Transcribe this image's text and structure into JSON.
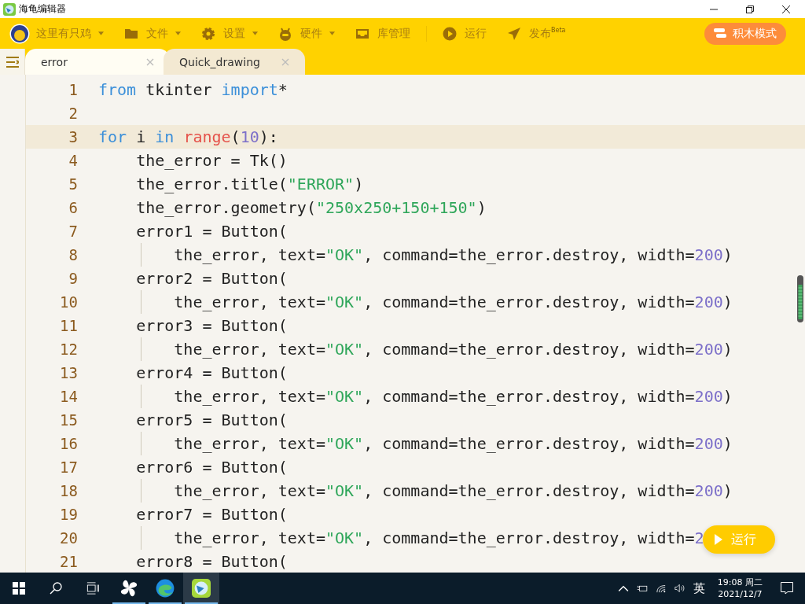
{
  "window": {
    "title": "海龟编辑器"
  },
  "toolbar": {
    "items": [
      {
        "kind": "user",
        "label": "这里有只鸡",
        "dropdown": true
      },
      {
        "kind": "file",
        "label": "文件",
        "dropdown": true
      },
      {
        "kind": "settings",
        "label": "设置",
        "dropdown": true
      },
      {
        "kind": "hardware",
        "label": "硬件",
        "dropdown": true
      },
      {
        "kind": "library",
        "label": "库管理",
        "dropdown": false
      },
      {
        "kind": "run",
        "label": "运行",
        "dropdown": false
      },
      {
        "kind": "publish",
        "label": "发布$^{Beta}$",
        "dropdown": false
      }
    ],
    "mode_button": "积木模式"
  },
  "tabs": [
    {
      "label": "error",
      "selected": true
    },
    {
      "label": "Quick_drawing",
      "selected": false
    }
  ],
  "editor": {
    "lines": [
      {
        "number": "1",
        "highlighted": false,
        "indent_guide": false,
        "tokens": [
          {
            "t": "from",
            "kind": "kw"
          },
          {
            "t": " tkinter ",
            "kind": "plain"
          },
          {
            "t": "import",
            "kind": "kw"
          },
          {
            "t": "*",
            "kind": "plain"
          }
        ]
      },
      {
        "number": "2",
        "highlighted": false,
        "indent_guide": false
      },
      {
        "number": "3",
        "highlighted": true,
        "indent_guide": false,
        "tokens": [
          {
            "t": "for",
            "kind": "kw"
          },
          {
            "t": " i ",
            "kind": "plain"
          },
          {
            "t": "in",
            "kind": "kw"
          },
          {
            "t": " range",
            "kind": "fn"
          },
          {
            "t": "(",
            "kind": "plain"
          },
          {
            "t": "10",
            "kind": "num"
          },
          {
            "t": "):",
            "kind": "plain"
          }
        ]
      },
      {
        "number": "4",
        "highlighted": false,
        "indent_guide": false,
        "tokens": [
          {
            "t": "    the_error = Tk()",
            "kind": "plain"
          }
        ]
      },
      {
        "number": "5",
        "highlighted": false,
        "indent_guide": false,
        "tokens": [
          {
            "t": "    the_error.title(",
            "kind": "plain"
          },
          {
            "t": "\"ERROR\"",
            "kind": "str"
          },
          {
            "t": ")",
            "kind": "plain"
          }
        ]
      },
      {
        "number": "6",
        "highlighted": false,
        "indent_guide": false,
        "tokens": [
          {
            "t": "    the_error.geometry(",
            "kind": "plain"
          },
          {
            "t": "\"250x250+150+150\"",
            "kind": "str"
          },
          {
            "t": ")",
            "kind": "plain"
          }
        ]
      },
      {
        "number": "7",
        "highlighted": false,
        "indent_guide": false,
        "tokens": [
          {
            "t": "    error1 = Button(",
            "kind": "plain"
          }
        ]
      },
      {
        "number": "8",
        "highlighted": false,
        "indent_guide": true,
        "tokens": [
          {
            "t": "        the_error, text=",
            "kind": "plain"
          },
          {
            "t": "\"OK\"",
            "kind": "str"
          },
          {
            "t": ", command=the_error.destroy, width=",
            "kind": "plain"
          },
          {
            "t": "200",
            "kind": "num"
          },
          {
            "t": ")",
            "kind": "plain"
          }
        ]
      },
      {
        "number": "9",
        "highlighted": false,
        "indent_guide": false,
        "tokens": [
          {
            "t": "    error2 = Button(",
            "kind": "plain"
          }
        ]
      },
      {
        "number": "10",
        "highlighted": false,
        "indent_guide": true,
        "tokens": [
          {
            "t": "        the_error, text=",
            "kind": "plain"
          },
          {
            "t": "\"OK\"",
            "kind": "str"
          },
          {
            "t": ", command=the_error.destroy, width=",
            "kind": "plain"
          },
          {
            "t": "200",
            "kind": "num"
          },
          {
            "t": ")",
            "kind": "plain"
          }
        ]
      },
      {
        "number": "11",
        "highlighted": false,
        "indent_guide": false,
        "tokens": [
          {
            "t": "    error3 = Button(",
            "kind": "plain"
          }
        ]
      },
      {
        "number": "12",
        "highlighted": false,
        "indent_guide": true,
        "tokens": [
          {
            "t": "        the_error, text=",
            "kind": "plain"
          },
          {
            "t": "\"OK\"",
            "kind": "str"
          },
          {
            "t": ", command=the_error.destroy, width=",
            "kind": "plain"
          },
          {
            "t": "200",
            "kind": "num"
          },
          {
            "t": ")",
            "kind": "plain"
          }
        ]
      },
      {
        "number": "13",
        "highlighted": false,
        "indent_guide": false,
        "tokens": [
          {
            "t": "    error4 = Button(",
            "kind": "plain"
          }
        ]
      },
      {
        "number": "14",
        "highlighted": false,
        "indent_guide": true,
        "tokens": [
          {
            "t": "        the_error, text=",
            "kind": "plain"
          },
          {
            "t": "\"OK\"",
            "kind": "str"
          },
          {
            "t": ", command=the_error.destroy, width=",
            "kind": "plain"
          },
          {
            "t": "200",
            "kind": "num"
          },
          {
            "t": ")",
            "kind": "plain"
          }
        ]
      },
      {
        "number": "15",
        "highlighted": false,
        "indent_guide": false,
        "tokens": [
          {
            "t": "    error5 = Button(",
            "kind": "plain"
          }
        ]
      },
      {
        "number": "16",
        "highlighted": false,
        "indent_guide": true,
        "tokens": [
          {
            "t": "        the_error, text=",
            "kind": "plain"
          },
          {
            "t": "\"OK\"",
            "kind": "str"
          },
          {
            "t": ", command=the_error.destroy, width=",
            "kind": "plain"
          },
          {
            "t": "200",
            "kind": "num"
          },
          {
            "t": ")",
            "kind": "plain"
          }
        ]
      },
      {
        "number": "17",
        "highlighted": false,
        "indent_guide": false,
        "tokens": [
          {
            "t": "    error6 = Button(",
            "kind": "plain"
          }
        ]
      },
      {
        "number": "18",
        "highlighted": false,
        "indent_guide": true,
        "tokens": [
          {
            "t": "        the_error, text=",
            "kind": "plain"
          },
          {
            "t": "\"OK\"",
            "kind": "str"
          },
          {
            "t": ", command=the_error.destroy, width=",
            "kind": "plain"
          },
          {
            "t": "200",
            "kind": "num"
          },
          {
            "t": ")",
            "kind": "plain"
          }
        ]
      },
      {
        "number": "19",
        "highlighted": false,
        "indent_guide": false,
        "tokens": [
          {
            "t": "    error7 = Button(",
            "kind": "plain"
          }
        ]
      },
      {
        "number": "20",
        "highlighted": false,
        "indent_guide": true,
        "tokens": [
          {
            "t": "        the_error, text=",
            "kind": "plain"
          },
          {
            "t": "\"OK\"",
            "kind": "str"
          },
          {
            "t": ", command=the_error.destroy, width=",
            "kind": "plain"
          },
          {
            "t": "2",
            "kind": "num"
          }
        ]
      },
      {
        "number": "21",
        "highlighted": false,
        "indent_guide": false,
        "tokens": [
          {
            "t": "    error8 = Button(",
            "kind": "plain"
          }
        ]
      }
    ],
    "run_button": "运行"
  },
  "taskbar": {
    "apps": [
      {
        "kind": "fan",
        "selected": false
      },
      {
        "kind": "edge",
        "selected": false
      },
      {
        "kind": "turtle",
        "selected": true
      }
    ],
    "input_method": "英",
    "time": "19:08 周二",
    "date": "2021/12/7"
  }
}
